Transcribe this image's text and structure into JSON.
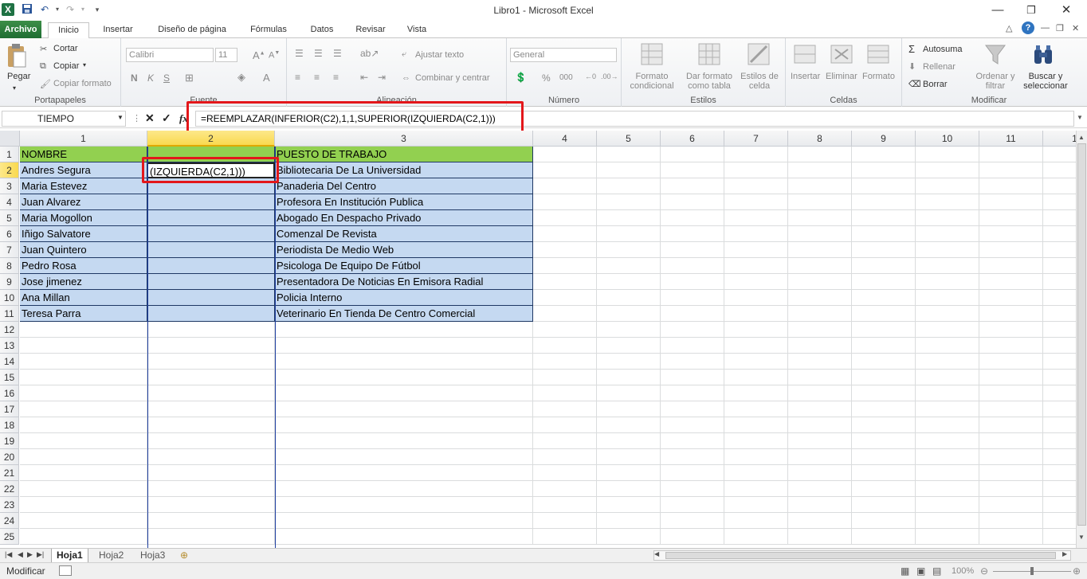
{
  "window": {
    "title": "Libro1  -  Microsoft Excel"
  },
  "tabs": {
    "file": "Archivo",
    "home": "Inicio",
    "insert": "Insertar",
    "layout": "Diseño de página",
    "formulas": "Fórmulas",
    "data": "Datos",
    "review": "Revisar",
    "view": "Vista"
  },
  "ribbon": {
    "clipboard": {
      "paste": "Pegar",
      "cut": "Cortar",
      "copy": "Copiar",
      "format_painter": "Copiar formato",
      "label": "Portapapeles"
    },
    "font": {
      "name": "Calibri",
      "size": "11",
      "label": "Fuente",
      "bold": "N",
      "italic": "K",
      "underline": "S"
    },
    "alignment": {
      "wrap": "Ajustar texto",
      "merge": "Combinar y centrar",
      "label": "Alineación"
    },
    "number": {
      "format": "General",
      "label": "Número",
      "percent": "%",
      "thousands": "000"
    },
    "styles": {
      "conditional": "Formato condicional",
      "table": "Dar formato como tabla",
      "cell": "Estilos de celda",
      "label": "Estilos"
    },
    "cells": {
      "insert": "Insertar",
      "delete": "Eliminar",
      "format": "Formato",
      "label": "Celdas"
    },
    "editing": {
      "autosum": "Autosuma",
      "fill": "Rellenar",
      "clear": "Borrar",
      "sort": "Ordenar y filtrar",
      "find": "Buscar y seleccionar",
      "label": "Modificar"
    }
  },
  "formula_bar": {
    "name_box": "TIEMPO",
    "cancel": "✕",
    "enter": "✓",
    "fx": "fx",
    "formula": "=REEMPLAZAR(INFERIOR(C2),1,1,SUPERIOR(IZQUIERDA(C2,1)))"
  },
  "grid": {
    "col_headers": [
      "1",
      "2",
      "3",
      "4",
      "5",
      "6",
      "7",
      "8",
      "9",
      "10",
      "11",
      "1"
    ],
    "row_headers": [
      "1",
      "2",
      "3",
      "4",
      "5",
      "6",
      "7",
      "8",
      "9",
      "10",
      "11",
      "12",
      "13",
      "14",
      "15",
      "16",
      "17",
      "18",
      "19",
      "20",
      "21",
      "22",
      "23",
      "24",
      "25"
    ],
    "header_row": {
      "name": "NOMBRE",
      "job": "PUESTO DE TRABAJO"
    },
    "editing_cell": "(IZQUIERDA(C2,1)))",
    "rows": [
      {
        "name": "Andres Segura",
        "job": "Bibliotecaria De La Universidad"
      },
      {
        "name": "Maria Estevez",
        "job": "Panaderia Del Centro"
      },
      {
        "name": "Juan Alvarez",
        "job": "Profesora En Institución Publica"
      },
      {
        "name": "Maria Mogollon",
        "job": "Abogado En Despacho Privado"
      },
      {
        "name": "Iñigo Salvatore",
        "job": "Comenzal De Revista"
      },
      {
        "name": "Juan Quintero",
        "job": "Periodista De Medio Web"
      },
      {
        "name": "Pedro Rosa",
        "job": "Psicologa De Equipo De Fútbol"
      },
      {
        "name": "Jose jimenez",
        "job": "Presentadora De Noticias En Emisora Radial"
      },
      {
        "name": "Ana Millan",
        "job": "Policia Interno"
      },
      {
        "name": "Teresa Parra",
        "job": "Veterinario En Tienda De Centro Comercial"
      }
    ]
  },
  "sheets": [
    "Hoja1",
    "Hoja2",
    "Hoja3"
  ],
  "status": {
    "mode": "Modificar",
    "zoom": "100%"
  },
  "colors": {
    "header_fill": "#92d050",
    "data_fill": "#c5d9f1",
    "highlight": "#e3171b",
    "file_tab": "#217346"
  }
}
